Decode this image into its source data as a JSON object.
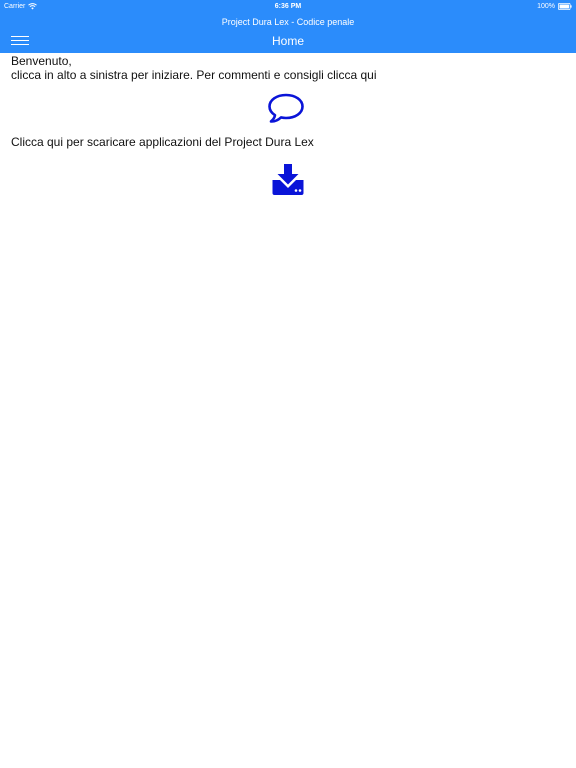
{
  "status_bar": {
    "carrier": "Carrier",
    "time": "6:36 PM",
    "battery": "100%"
  },
  "header": {
    "app_title": "Project Dura Lex - Codice penale",
    "nav_title": "Home"
  },
  "content": {
    "welcome_line1": "Benvenuto,",
    "welcome_line2": "clicca in alto a sinistra per iniziare. Per commenti e consigli clicca qui",
    "download_text": "Clicca qui per scaricare applicazioni del Project Dura Lex"
  },
  "icons": {
    "comment": "speech-bubble-icon",
    "download": "download-tray-icon",
    "menu": "hamburger-menu-icon",
    "wifi": "wifi-icon",
    "battery": "battery-icon"
  },
  "colors": {
    "header_bg": "#2b8cfb",
    "icon_blue": "#0a14d8",
    "text": "#111111"
  }
}
